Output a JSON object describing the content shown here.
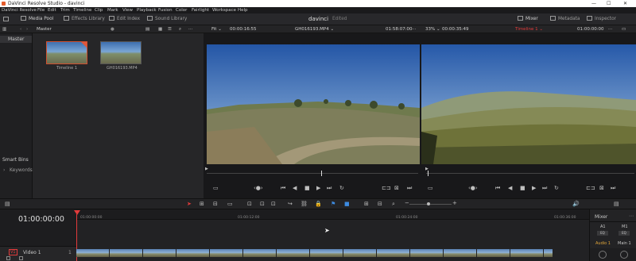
{
  "window": {
    "title": "DaVinci Resolve Studio - davinci"
  },
  "menu": [
    "DaVinci Resolve",
    "File",
    "Edit",
    "Trim",
    "Timeline",
    "Clip",
    "Mark",
    "View",
    "Playback",
    "Fusion",
    "Color",
    "Fairlight",
    "Workspace",
    "Help"
  ],
  "topbar": {
    "media_pool": "Media Pool",
    "effects_library": "Effects Library",
    "edit_index": "Edit Index",
    "sound_library": "Sound Library",
    "project": "davinci",
    "status": "Edited",
    "mixer": "Mixer",
    "metadata": "Metadata",
    "inspector": "Inspector"
  },
  "subbar": {
    "bin": "Master",
    "fit": "Fit",
    "source_timecode_left": "00:00:16:55",
    "source_clip": "GH016193.MP4",
    "source_timecode_right": "01:58:07:00",
    "zoom": "33%",
    "program_timecode_left": "00:00:35:49",
    "timeline_name": "Timeline 1",
    "program_timecode_right": "01:00:00:00"
  },
  "bins": {
    "master": "Master",
    "smart_bins": "Smart Bins",
    "keywords": "Keywords"
  },
  "media": [
    {
      "name": "Timeline 1"
    },
    {
      "name": "GH016193.MP4"
    }
  ],
  "timeline": {
    "timecode": "01:00:00:00",
    "ruler": [
      "01:00:00:00",
      "01:00:12:00",
      "01:00:24:00",
      "01:00:36:00"
    ],
    "track_id": "V1",
    "track_name": "Video 1"
  },
  "mixer": {
    "title": "Mixer",
    "a1": "A1",
    "m1": "M1",
    "audio1": "Audio 1",
    "main1": "Main 1"
  },
  "colors": {
    "accent_red": "#e23b3b",
    "bg": "#1f1f21"
  }
}
